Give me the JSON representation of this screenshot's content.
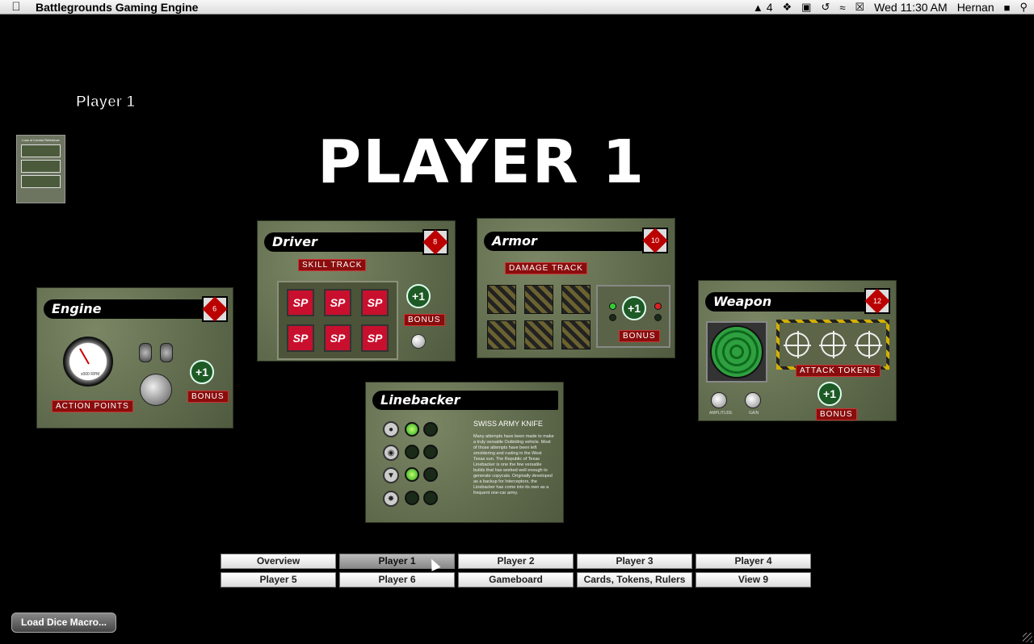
{
  "menubar": {
    "app_name": "Battlegrounds Gaming Engine",
    "adobe_count": "4",
    "clock": "Wed 11:30 AM",
    "user": "Hernan"
  },
  "header": {
    "player_label": "Player 1",
    "big_title": "PLAYER 1"
  },
  "reference_card": {
    "title": "Loss of Control Reference"
  },
  "engine": {
    "title": "Engine",
    "action_points_label": "ACTION POINTS",
    "bonus_label": "BONUS",
    "plus_label": "+1",
    "gauge_label": "x000 RPM",
    "die_face": "6"
  },
  "driver": {
    "title": "Driver",
    "die_face": "8",
    "skill_track_label": "SKILL TRACK",
    "sp_tokens": [
      "SP",
      "SP",
      "SP",
      "SP",
      "SP",
      "SP"
    ],
    "plus_label": "+1",
    "bonus_label": "BONUS"
  },
  "armor": {
    "title": "Armor",
    "die_face": "10",
    "damage_track_label": "DAMAGE TRACK",
    "plus_label": "+1",
    "bonus_label": "BONUS"
  },
  "weapon": {
    "title": "Weapon",
    "die_face": "12",
    "attack_tokens_label": "ATTACK TOKENS",
    "plus_label": "+1",
    "bonus_label": "BONUS",
    "knob1_label": "AMPLITUDE",
    "knob2_label": "GAIN"
  },
  "linebacker": {
    "title": "Linebacker",
    "subtitle": "SWISS ARMY KNIFE",
    "description": "Many attempts have been made to make a truly versatile Outbiding vehicle. Most of those attempts have been left smoldering and rusting in the West Texas sun. The Republic of Texas Linebacker is one the few versatile builds that has worked well enough to generate copycats. Originally developed as a backup for Interceptors, the Linebacker has come into its own as a frequent one-car army.",
    "rows": [
      {
        "icon": "driver-icon",
        "leds": [
          true,
          false
        ]
      },
      {
        "icon": "steering-icon",
        "leds": [
          false,
          false
        ]
      },
      {
        "icon": "armor-icon",
        "leds": [
          true,
          false
        ]
      },
      {
        "icon": "crash-icon",
        "leds": [
          false,
          false
        ]
      }
    ]
  },
  "nav": {
    "buttons": [
      "Overview",
      "Player 1",
      "Player 2",
      "Player 3",
      "Player 4",
      "Player 5",
      "Player 6",
      "Gameboard",
      "Cards, Tokens, Rulers",
      "View 9"
    ],
    "active": "Player 1"
  },
  "load_button": "Load Dice Macro..."
}
